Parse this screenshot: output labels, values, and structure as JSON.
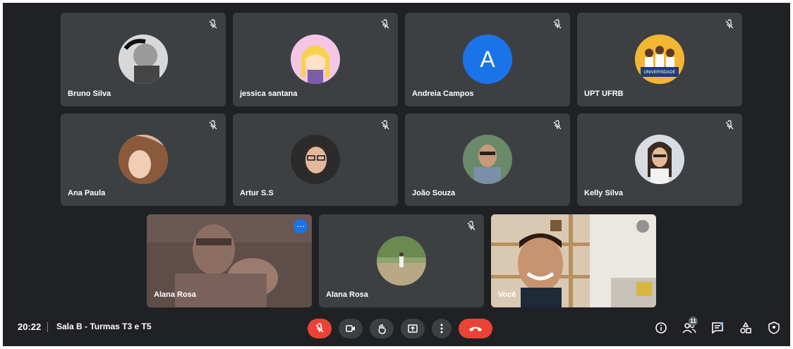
{
  "participants_row1": [
    {
      "name": "Bruno Silva",
      "avatar": "photo"
    },
    {
      "name": "jessica santana",
      "avatar": "illustration"
    },
    {
      "name": "Andreia Campos",
      "avatar": "letter",
      "letter": "A",
      "color": "#1a73e8"
    },
    {
      "name": "UPT UFRB",
      "avatar": "logo",
      "logo_text": "UNIVERSIDADE PARA TODOS"
    }
  ],
  "participants_row2": [
    {
      "name": "Ana Paula"
    },
    {
      "name": "Artur S.S"
    },
    {
      "name": "João Souza"
    },
    {
      "name": "Kelly Silva"
    }
  ],
  "participants_row3": [
    {
      "name": "Alana Rosa",
      "state": "video",
      "active": true
    },
    {
      "name": "Alana Rosa",
      "state": "avatar"
    },
    {
      "name": "Você",
      "state": "video"
    }
  ],
  "bottom_bar": {
    "time": "20:22",
    "meeting_title": "Sala B - Turmas T3 e T5",
    "participant_count": "11"
  },
  "colors": {
    "background": "#202124",
    "tile": "#3c4043",
    "accent": "#1a73e8",
    "danger": "#ea4335"
  },
  "icons": {
    "mic": "mic-off-icon",
    "camera": "camera-icon",
    "hand": "raise-hand-icon",
    "present": "present-screen-icon",
    "more": "more-options-icon",
    "leave": "leave-call-icon",
    "info": "info-icon",
    "people": "people-icon",
    "chat": "chat-icon",
    "activities": "activities-icon",
    "host": "host-controls-icon"
  }
}
